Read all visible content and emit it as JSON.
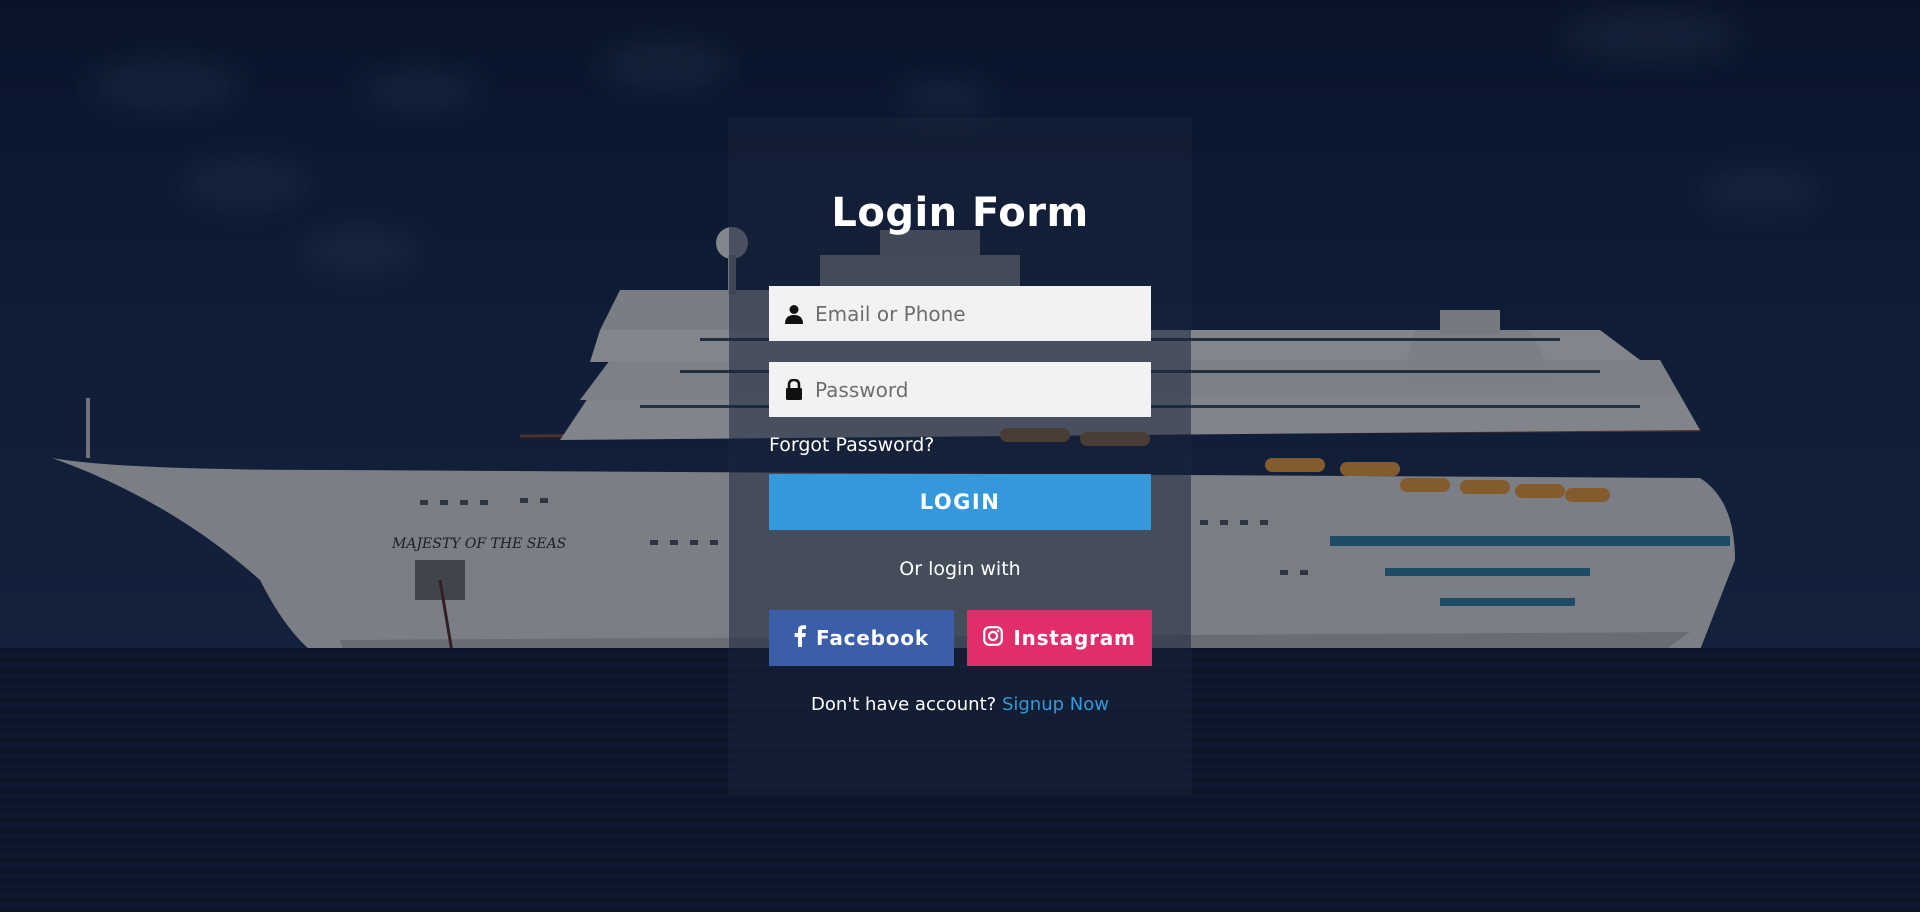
{
  "form": {
    "title": "Login Form",
    "email_placeholder": "Email or Phone",
    "password_placeholder": "Password",
    "forgot_password": "Forgot Password?",
    "login_label": "LOGIN",
    "or_login_with": "Or login with",
    "facebook_label": "Facebook",
    "instagram_label": "Instagram",
    "signup_prompt": "Don't have account?",
    "signup_link": "Signup Now"
  },
  "background": {
    "ship_name_text": "MAJESTY OF THE SEAS"
  },
  "colors": {
    "accent": "#3498db",
    "facebook": "#3b5ea8",
    "instagram": "#e12e6b",
    "input_bg": "#f2f2f2"
  },
  "icons": {
    "email": "user-icon",
    "password": "lock-icon",
    "facebook": "facebook-icon",
    "instagram": "instagram-icon"
  }
}
